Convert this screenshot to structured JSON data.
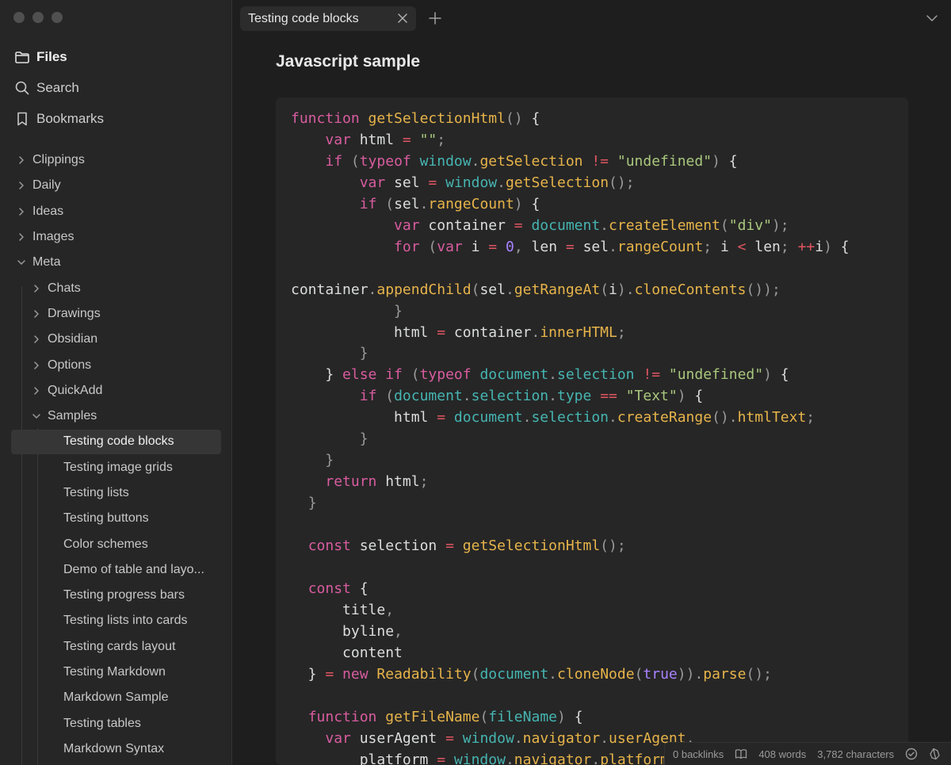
{
  "sidebar": {
    "nav": [
      {
        "label": "Files",
        "icon": "folder-icon",
        "active": true
      },
      {
        "label": "Search",
        "icon": "search-icon",
        "active": false
      },
      {
        "label": "Bookmarks",
        "icon": "bookmark-icon",
        "active": false
      }
    ],
    "tree": [
      {
        "label": "Clippings",
        "level": 0,
        "folder": true,
        "open": false
      },
      {
        "label": "Daily",
        "level": 0,
        "folder": true,
        "open": false
      },
      {
        "label": "Ideas",
        "level": 0,
        "folder": true,
        "open": false
      },
      {
        "label": "Images",
        "level": 0,
        "folder": true,
        "open": false
      },
      {
        "label": "Meta",
        "level": 0,
        "folder": true,
        "open": true
      },
      {
        "label": "Chats",
        "level": 1,
        "folder": true,
        "open": false
      },
      {
        "label": "Drawings",
        "level": 1,
        "folder": true,
        "open": false
      },
      {
        "label": "Obsidian",
        "level": 1,
        "folder": true,
        "open": false
      },
      {
        "label": "Options",
        "level": 1,
        "folder": true,
        "open": false
      },
      {
        "label": "QuickAdd",
        "level": 1,
        "folder": true,
        "open": false
      },
      {
        "label": "Samples",
        "level": 1,
        "folder": true,
        "open": true
      },
      {
        "label": "Testing code blocks",
        "level": 2,
        "folder": false,
        "selected": true
      },
      {
        "label": "Testing image grids",
        "level": 2,
        "folder": false
      },
      {
        "label": "Testing lists",
        "level": 2,
        "folder": false
      },
      {
        "label": "Testing buttons",
        "level": 2,
        "folder": false
      },
      {
        "label": "Color schemes",
        "level": 2,
        "folder": false
      },
      {
        "label": "Demo of table and layo...",
        "level": 2,
        "folder": false
      },
      {
        "label": "Testing progress bars",
        "level": 2,
        "folder": false
      },
      {
        "label": "Testing lists into cards",
        "level": 2,
        "folder": false
      },
      {
        "label": "Testing cards layout",
        "level": 2,
        "folder": false
      },
      {
        "label": "Testing Markdown",
        "level": 2,
        "folder": false
      },
      {
        "label": "Markdown Sample",
        "level": 2,
        "folder": false
      },
      {
        "label": "Testing tables",
        "level": 2,
        "folder": false
      },
      {
        "label": "Markdown Syntax",
        "level": 2,
        "folder": false
      }
    ]
  },
  "tab": {
    "title": "Testing code blocks"
  },
  "note": {
    "heading": "Javascript sample"
  },
  "code": [
    [
      [
        "k",
        "function "
      ],
      [
        "f",
        "getSelectionHtml"
      ],
      [
        "p",
        "() "
      ],
      [
        "v",
        "{"
      ]
    ],
    [
      [
        "v",
        "    "
      ],
      [
        "k",
        "var "
      ],
      [
        "v",
        "html "
      ],
      [
        "o",
        "= "
      ],
      [
        "s",
        "\"\""
      ],
      [
        "p",
        ";"
      ]
    ],
    [
      [
        "v",
        "    "
      ],
      [
        "k",
        "if "
      ],
      [
        "p",
        "("
      ],
      [
        "k",
        "typeof "
      ],
      [
        "b",
        "window"
      ],
      [
        "p",
        "."
      ],
      [
        "f",
        "getSelection "
      ],
      [
        "o",
        "!= "
      ],
      [
        "s",
        "\"undefined\""
      ],
      [
        "p",
        ") "
      ],
      [
        "v",
        "{"
      ]
    ],
    [
      [
        "v",
        "        "
      ],
      [
        "k",
        "var "
      ],
      [
        "v",
        "sel "
      ],
      [
        "o",
        "= "
      ],
      [
        "b",
        "window"
      ],
      [
        "p",
        "."
      ],
      [
        "f",
        "getSelection"
      ],
      [
        "p",
        "();"
      ]
    ],
    [
      [
        "v",
        "        "
      ],
      [
        "k",
        "if "
      ],
      [
        "p",
        "("
      ],
      [
        "v",
        "sel"
      ],
      [
        "p",
        "."
      ],
      [
        "f",
        "rangeCount"
      ],
      [
        "p",
        ") "
      ],
      [
        "v",
        "{"
      ]
    ],
    [
      [
        "v",
        "            "
      ],
      [
        "k",
        "var "
      ],
      [
        "v",
        "container "
      ],
      [
        "o",
        "= "
      ],
      [
        "b",
        "document"
      ],
      [
        "p",
        "."
      ],
      [
        "f",
        "createElement"
      ],
      [
        "p",
        "("
      ],
      [
        "s",
        "\"div\""
      ],
      [
        "p",
        ");"
      ]
    ],
    [
      [
        "v",
        "            "
      ],
      [
        "k",
        "for "
      ],
      [
        "p",
        "("
      ],
      [
        "k",
        "var "
      ],
      [
        "v",
        "i "
      ],
      [
        "o",
        "= "
      ],
      [
        "n",
        "0"
      ],
      [
        "p",
        ", "
      ],
      [
        "v",
        "len "
      ],
      [
        "o",
        "= "
      ],
      [
        "v",
        "sel"
      ],
      [
        "p",
        "."
      ],
      [
        "f",
        "rangeCount"
      ],
      [
        "p",
        "; "
      ],
      [
        "v",
        "i "
      ],
      [
        "o",
        "< "
      ],
      [
        "v",
        "len"
      ],
      [
        "p",
        "; "
      ],
      [
        "o",
        "++"
      ],
      [
        "v",
        "i"
      ],
      [
        "p",
        ") "
      ],
      [
        "v",
        "{"
      ]
    ],
    [
      [
        "v",
        ""
      ]
    ],
    [
      [
        "v",
        "container"
      ],
      [
        "p",
        "."
      ],
      [
        "f",
        "appendChild"
      ],
      [
        "p",
        "("
      ],
      [
        "v",
        "sel"
      ],
      [
        "p",
        "."
      ],
      [
        "f",
        "getRangeAt"
      ],
      [
        "p",
        "("
      ],
      [
        "v",
        "i"
      ],
      [
        "p",
        ")."
      ],
      [
        "f",
        "cloneContents"
      ],
      [
        "p",
        "());"
      ]
    ],
    [
      [
        "v",
        "            "
      ],
      [
        "p",
        "}"
      ]
    ],
    [
      [
        "v",
        "            html "
      ],
      [
        "o",
        "= "
      ],
      [
        "v",
        "container"
      ],
      [
        "p",
        "."
      ],
      [
        "f",
        "innerHTML"
      ],
      [
        "p",
        ";"
      ]
    ],
    [
      [
        "v",
        "        "
      ],
      [
        "p",
        "}"
      ]
    ],
    [
      [
        "v",
        "    } "
      ],
      [
        "k",
        "else if "
      ],
      [
        "p",
        "("
      ],
      [
        "k",
        "typeof "
      ],
      [
        "b",
        "document"
      ],
      [
        "p",
        "."
      ],
      [
        "b",
        "selection "
      ],
      [
        "o",
        "!= "
      ],
      [
        "s",
        "\"undefined\""
      ],
      [
        "p",
        ") "
      ],
      [
        "v",
        "{"
      ]
    ],
    [
      [
        "v",
        "        "
      ],
      [
        "k",
        "if "
      ],
      [
        "p",
        "("
      ],
      [
        "b",
        "document"
      ],
      [
        "p",
        "."
      ],
      [
        "b",
        "selection"
      ],
      [
        "p",
        "."
      ],
      [
        "b",
        "type "
      ],
      [
        "o",
        "== "
      ],
      [
        "s",
        "\"Text\""
      ],
      [
        "p",
        ") "
      ],
      [
        "v",
        "{"
      ]
    ],
    [
      [
        "v",
        "            html "
      ],
      [
        "o",
        "= "
      ],
      [
        "b",
        "document"
      ],
      [
        "p",
        "."
      ],
      [
        "b",
        "selection"
      ],
      [
        "p",
        "."
      ],
      [
        "f",
        "createRange"
      ],
      [
        "p",
        "()."
      ],
      [
        "f",
        "htmlText"
      ],
      [
        "p",
        ";"
      ]
    ],
    [
      [
        "v",
        "        "
      ],
      [
        "p",
        "}"
      ]
    ],
    [
      [
        "v",
        "    "
      ],
      [
        "p",
        "}"
      ]
    ],
    [
      [
        "v",
        "    "
      ],
      [
        "k",
        "return "
      ],
      [
        "v",
        "html"
      ],
      [
        "p",
        ";"
      ]
    ],
    [
      [
        "v",
        "  "
      ],
      [
        "p",
        "}"
      ]
    ],
    [
      [
        "v",
        ""
      ]
    ],
    [
      [
        "v",
        "  "
      ],
      [
        "k",
        "const "
      ],
      [
        "v",
        "selection "
      ],
      [
        "o",
        "= "
      ],
      [
        "f",
        "getSelectionHtml"
      ],
      [
        "p",
        "();"
      ]
    ],
    [
      [
        "v",
        ""
      ]
    ],
    [
      [
        "v",
        "  "
      ],
      [
        "k",
        "const "
      ],
      [
        "v",
        "{"
      ]
    ],
    [
      [
        "v",
        "      title"
      ],
      [
        "p",
        ","
      ]
    ],
    [
      [
        "v",
        "      byline"
      ],
      [
        "p",
        ","
      ]
    ],
    [
      [
        "v",
        "      content"
      ]
    ],
    [
      [
        "v",
        "  } "
      ],
      [
        "o",
        "= "
      ],
      [
        "k",
        "new "
      ],
      [
        "f",
        "Readability"
      ],
      [
        "p",
        "("
      ],
      [
        "b",
        "document"
      ],
      [
        "p",
        "."
      ],
      [
        "f",
        "cloneNode"
      ],
      [
        "p",
        "("
      ],
      [
        "n",
        "true"
      ],
      [
        "p",
        "))."
      ],
      [
        "f",
        "parse"
      ],
      [
        "p",
        "();"
      ]
    ],
    [
      [
        "v",
        ""
      ]
    ],
    [
      [
        "v",
        "  "
      ],
      [
        "k",
        "function "
      ],
      [
        "f",
        "getFileName"
      ],
      [
        "p",
        "("
      ],
      [
        "b",
        "fileName"
      ],
      [
        "p",
        ") "
      ],
      [
        "v",
        "{"
      ]
    ],
    [
      [
        "v",
        "    "
      ],
      [
        "k",
        "var "
      ],
      [
        "v",
        "userAgent "
      ],
      [
        "o",
        "= "
      ],
      [
        "b",
        "window"
      ],
      [
        "p",
        "."
      ],
      [
        "f",
        "navigator"
      ],
      [
        "p",
        "."
      ],
      [
        "f",
        "userAgent"
      ],
      [
        "p",
        ","
      ]
    ],
    [
      [
        "v",
        "        platform "
      ],
      [
        "o",
        "= "
      ],
      [
        "b",
        "window"
      ],
      [
        "p",
        "."
      ],
      [
        "f",
        "navigator"
      ],
      [
        "p",
        "."
      ],
      [
        "f",
        "platform"
      ],
      [
        "p",
        ","
      ]
    ]
  ],
  "status": {
    "backlinks": "0 backlinks",
    "words": "408 words",
    "characters": "3,782 characters"
  }
}
